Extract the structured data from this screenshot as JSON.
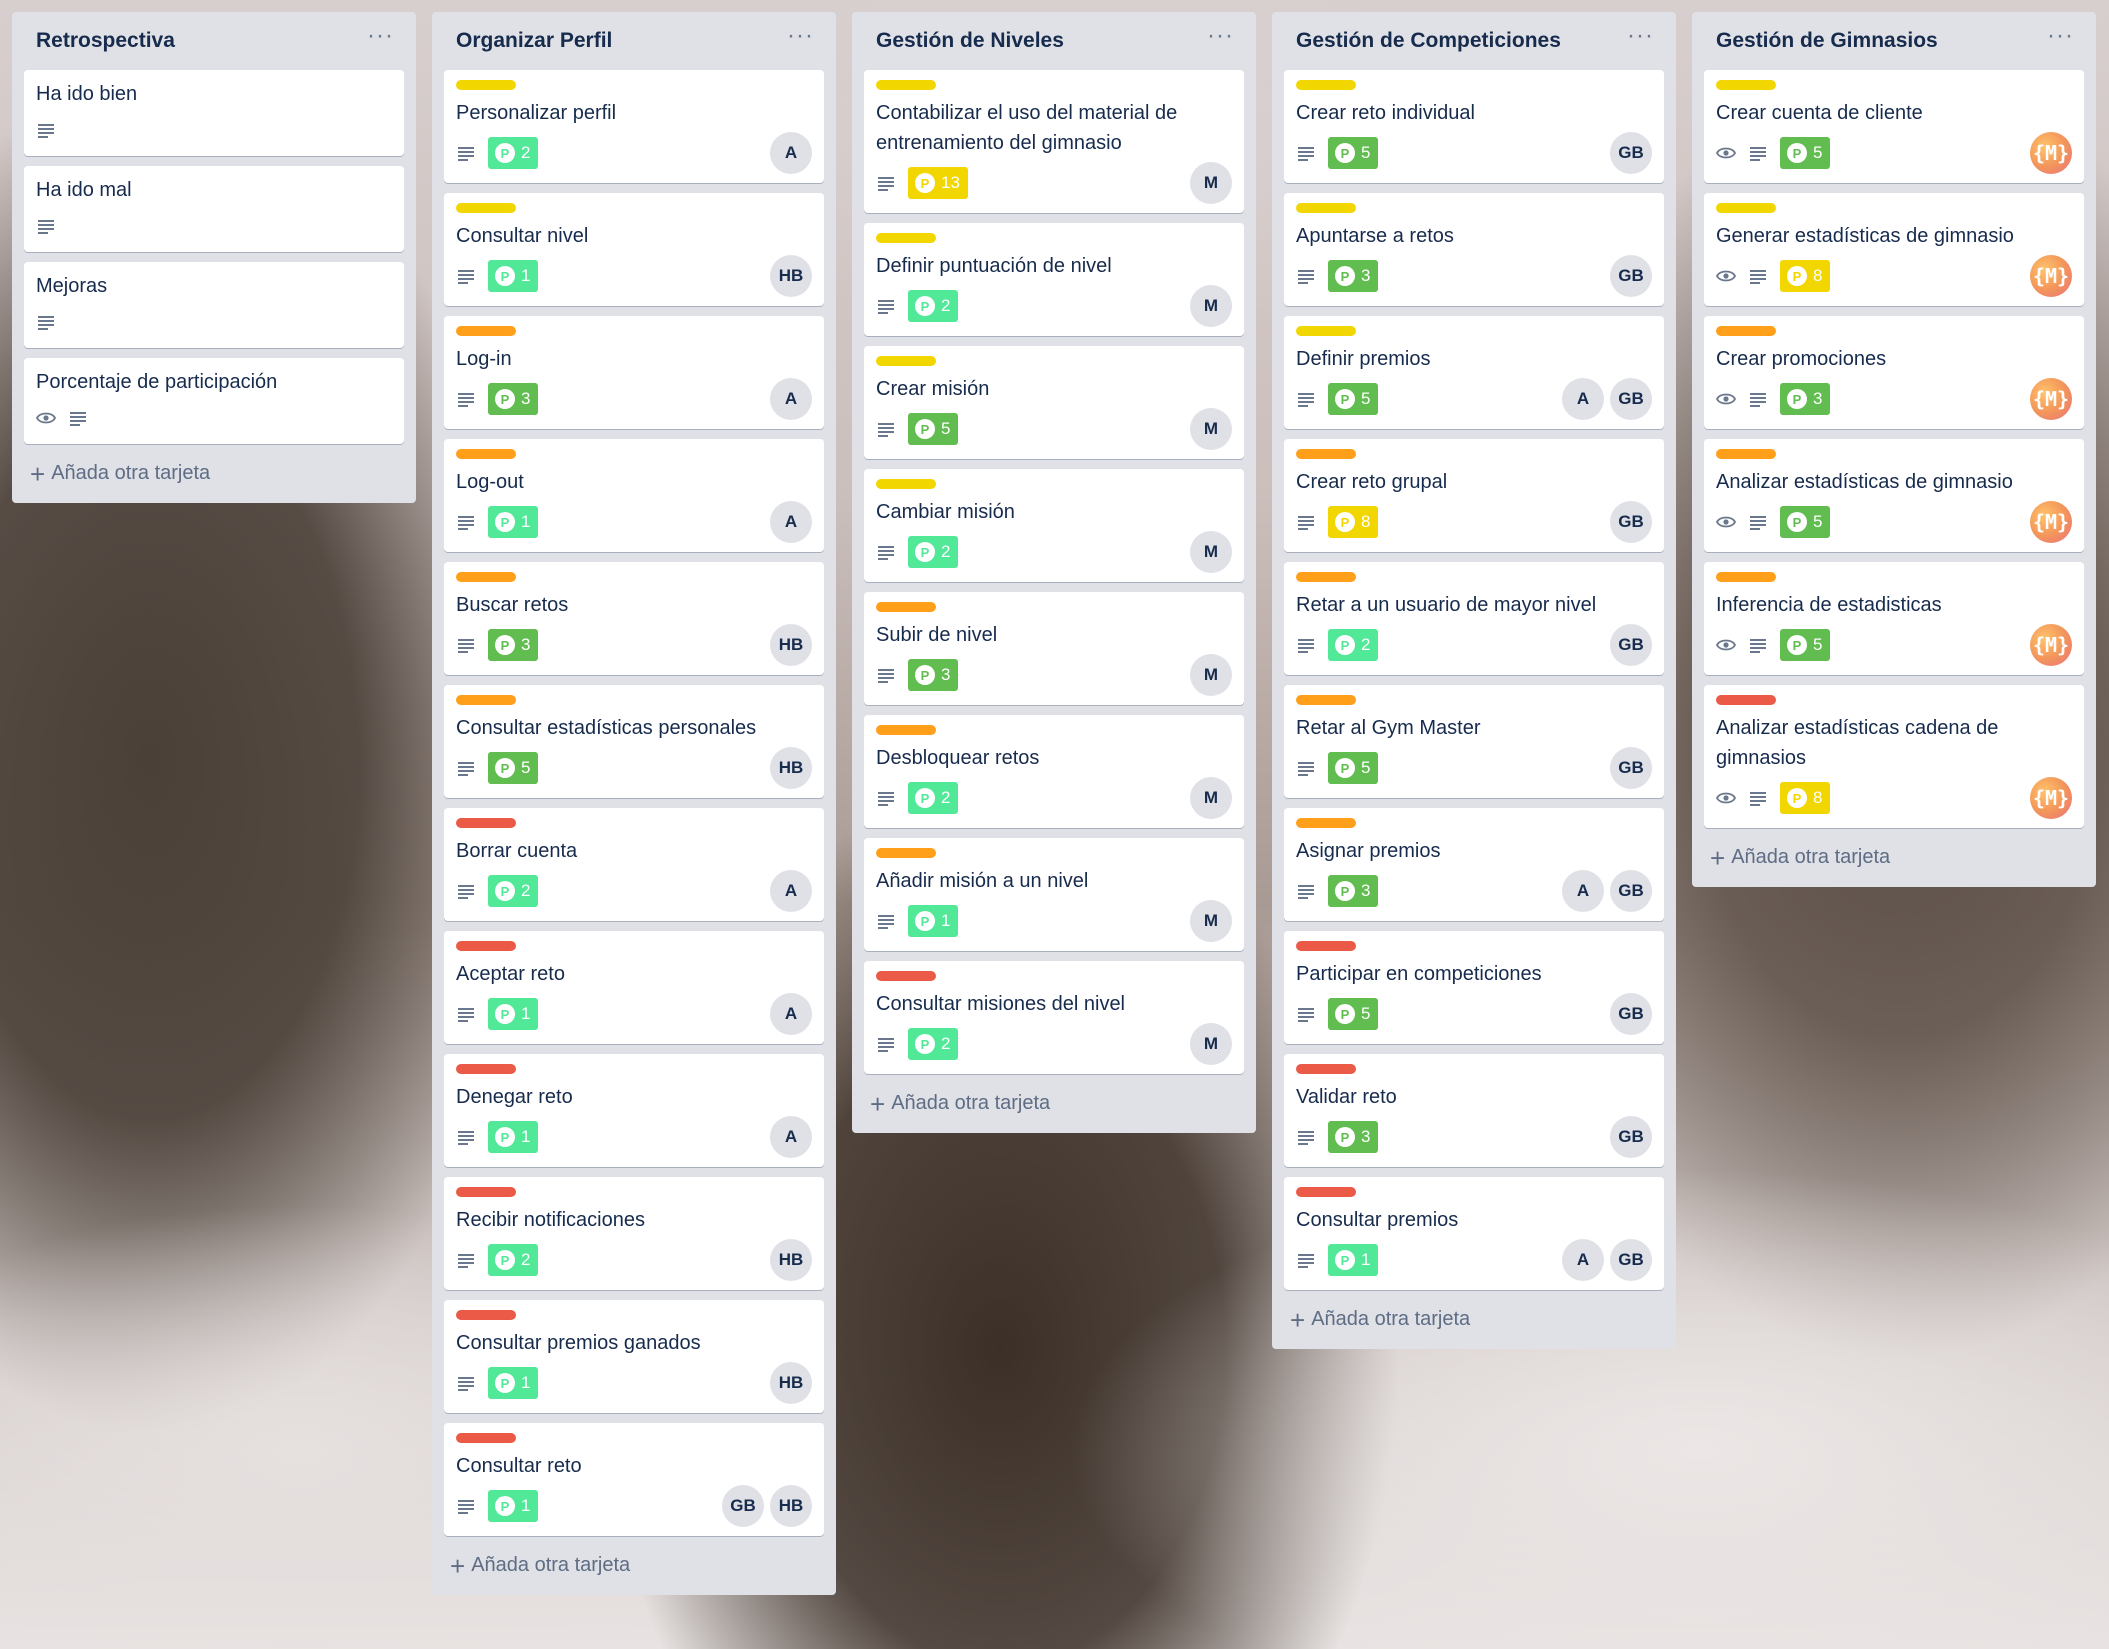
{
  "colors": {
    "label_yellow": "#f2d600",
    "label_orange": "#ff9f1a",
    "label_red": "#eb5a46",
    "points_green_light": "#51e898",
    "points_green": "#61bd4f",
    "points_yellow": "#f2d600"
  },
  "lists": [
    {
      "title": "Retrospectiva",
      "menu": "···",
      "add_card": "Añada otra tarjeta",
      "cards": [
        {
          "title": "Ha ido bien",
          "label": null,
          "watch": false,
          "description": true,
          "points": null,
          "members": []
        },
        {
          "title": "Ha ido mal",
          "label": null,
          "watch": false,
          "description": true,
          "points": null,
          "members": []
        },
        {
          "title": "Mejoras",
          "label": null,
          "watch": false,
          "description": true,
          "points": null,
          "members": []
        },
        {
          "title": "Porcentaje de participación",
          "label": null,
          "watch": true,
          "description": true,
          "points": null,
          "members": []
        }
      ]
    },
    {
      "title": "Organizar Perfil",
      "menu": "···",
      "add_card": "Añada otra tarjeta",
      "cards": [
        {
          "title": "Personalizar perfil",
          "label": "yellow",
          "watch": false,
          "description": true,
          "points": {
            "value": "2",
            "color": "green_light"
          },
          "members": [
            "A"
          ]
        },
        {
          "title": "Consultar nivel",
          "label": "yellow",
          "watch": false,
          "description": true,
          "points": {
            "value": "1",
            "color": "green_light"
          },
          "members": [
            "HB"
          ]
        },
        {
          "title": "Log-in",
          "label": "orange",
          "watch": false,
          "description": true,
          "points": {
            "value": "3",
            "color": "green"
          },
          "members": [
            "A"
          ]
        },
        {
          "title": "Log-out",
          "label": "orange",
          "watch": false,
          "description": true,
          "points": {
            "value": "1",
            "color": "green_light"
          },
          "members": [
            "A"
          ]
        },
        {
          "title": "Buscar retos",
          "label": "orange",
          "watch": false,
          "description": true,
          "points": {
            "value": "3",
            "color": "green"
          },
          "members": [
            "HB"
          ]
        },
        {
          "title": "Consultar estadísticas personales",
          "label": "orange",
          "watch": false,
          "description": true,
          "points": {
            "value": "5",
            "color": "green"
          },
          "members": [
            "HB"
          ]
        },
        {
          "title": "Borrar cuenta",
          "label": "red",
          "watch": false,
          "description": true,
          "points": {
            "value": "2",
            "color": "green_light"
          },
          "members": [
            "A"
          ]
        },
        {
          "title": "Aceptar reto",
          "label": "red",
          "watch": false,
          "description": true,
          "points": {
            "value": "1",
            "color": "green_light"
          },
          "members": [
            "A"
          ]
        },
        {
          "title": "Denegar reto",
          "label": "red",
          "watch": false,
          "description": true,
          "points": {
            "value": "1",
            "color": "green_light"
          },
          "members": [
            "A"
          ]
        },
        {
          "title": "Recibir notificaciones",
          "label": "red",
          "watch": false,
          "description": true,
          "points": {
            "value": "2",
            "color": "green_light"
          },
          "members": [
            "HB"
          ]
        },
        {
          "title": "Consultar premios ganados",
          "label": "red",
          "watch": false,
          "description": true,
          "points": {
            "value": "1",
            "color": "green_light"
          },
          "members": [
            "HB"
          ]
        },
        {
          "title": "Consultar reto",
          "label": "red",
          "watch": false,
          "description": true,
          "points": {
            "value": "1",
            "color": "green_light"
          },
          "members": [
            "GB",
            "HB"
          ]
        }
      ]
    },
    {
      "title": "Gestión de Niveles",
      "menu": "···",
      "add_card": "Añada otra tarjeta",
      "cards": [
        {
          "title": "Contabilizar el uso del material de entrenamiento del gimnasio",
          "label": "yellow",
          "watch": false,
          "description": true,
          "points": {
            "value": "13",
            "color": "yellow"
          },
          "members": [
            "M"
          ]
        },
        {
          "title": "Definir puntuación de nivel",
          "label": "yellow",
          "watch": false,
          "description": true,
          "points": {
            "value": "2",
            "color": "green_light"
          },
          "members": [
            "M"
          ]
        },
        {
          "title": "Crear misión",
          "label": "yellow",
          "watch": false,
          "description": true,
          "points": {
            "value": "5",
            "color": "green"
          },
          "members": [
            "M"
          ]
        },
        {
          "title": "Cambiar misión",
          "label": "yellow",
          "watch": false,
          "description": true,
          "points": {
            "value": "2",
            "color": "green_light"
          },
          "members": [
            "M"
          ]
        },
        {
          "title": "Subir de nivel",
          "label": "orange",
          "watch": false,
          "description": true,
          "points": {
            "value": "3",
            "color": "green"
          },
          "members": [
            "M"
          ]
        },
        {
          "title": "Desbloquear retos",
          "label": "orange",
          "watch": false,
          "description": true,
          "points": {
            "value": "2",
            "color": "green_light"
          },
          "members": [
            "M"
          ]
        },
        {
          "title": "Añadir misión a un nivel",
          "label": "orange",
          "watch": false,
          "description": true,
          "points": {
            "value": "1",
            "color": "green_light"
          },
          "members": [
            "M"
          ]
        },
        {
          "title": "Consultar misiones del nivel",
          "label": "red",
          "watch": false,
          "description": true,
          "points": {
            "value": "2",
            "color": "green_light"
          },
          "members": [
            "M"
          ]
        }
      ]
    },
    {
      "title": "Gestión de Competiciones",
      "menu": "···",
      "add_card": "Añada otra tarjeta",
      "cards": [
        {
          "title": "Crear reto individual",
          "label": "yellow",
          "watch": false,
          "description": true,
          "points": {
            "value": "5",
            "color": "green"
          },
          "members": [
            "GB"
          ]
        },
        {
          "title": "Apuntarse a retos",
          "label": "yellow",
          "watch": false,
          "description": true,
          "points": {
            "value": "3",
            "color": "green"
          },
          "members": [
            "GB"
          ]
        },
        {
          "title": "Definir premios",
          "label": "yellow",
          "watch": false,
          "description": true,
          "points": {
            "value": "5",
            "color": "green"
          },
          "members": [
            "A",
            "GB"
          ]
        },
        {
          "title": "Crear reto grupal",
          "label": "orange",
          "watch": false,
          "description": true,
          "points": {
            "value": "8",
            "color": "yellow"
          },
          "members": [
            "GB"
          ]
        },
        {
          "title": "Retar a un usuario de mayor nivel",
          "label": "orange",
          "watch": false,
          "description": true,
          "points": {
            "value": "2",
            "color": "green_light"
          },
          "members": [
            "GB"
          ]
        },
        {
          "title": "Retar al Gym Master",
          "label": "orange",
          "watch": false,
          "description": true,
          "points": {
            "value": "5",
            "color": "green"
          },
          "members": [
            "GB"
          ]
        },
        {
          "title": "Asignar premios",
          "label": "orange",
          "watch": false,
          "description": true,
          "points": {
            "value": "3",
            "color": "green"
          },
          "members": [
            "A",
            "GB"
          ]
        },
        {
          "title": "Participar en competiciones",
          "label": "red",
          "watch": false,
          "description": true,
          "points": {
            "value": "5",
            "color": "green"
          },
          "members": [
            "GB"
          ]
        },
        {
          "title": "Validar reto",
          "label": "red",
          "watch": false,
          "description": true,
          "points": {
            "value": "3",
            "color": "green"
          },
          "members": [
            "GB"
          ]
        },
        {
          "title": "Consultar premios",
          "label": "red",
          "watch": false,
          "description": true,
          "points": {
            "value": "1",
            "color": "green_light"
          },
          "members": [
            "A",
            "GB"
          ]
        }
      ]
    },
    {
      "title": "Gestión de Gimnasios",
      "menu": "···",
      "add_card": "Añada otra tarjeta",
      "cards": [
        {
          "title": "Crear cuenta de cliente",
          "label": "yellow",
          "watch": true,
          "description": true,
          "points": {
            "value": "5",
            "color": "green"
          },
          "members": [
            "{M}"
          ]
        },
        {
          "title": "Generar estadísticas de gimnasio",
          "label": "yellow",
          "watch": true,
          "description": true,
          "points": {
            "value": "8",
            "color": "yellow"
          },
          "members": [
            "{M}"
          ]
        },
        {
          "title": "Crear promociones",
          "label": "orange",
          "watch": true,
          "description": true,
          "points": {
            "value": "3",
            "color": "green"
          },
          "members": [
            "{M}"
          ]
        },
        {
          "title": "Analizar estadísticas de gimnasio",
          "label": "orange",
          "watch": true,
          "description": true,
          "points": {
            "value": "5",
            "color": "green"
          },
          "members": [
            "{M}"
          ]
        },
        {
          "title": "Inferencia de estadisticas",
          "label": "orange",
          "watch": true,
          "description": true,
          "points": {
            "value": "5",
            "color": "green"
          },
          "members": [
            "{M}"
          ]
        },
        {
          "title": "Analizar estadísticas cadena de gimnasios",
          "label": "red",
          "watch": true,
          "description": true,
          "points": {
            "value": "8",
            "color": "yellow"
          },
          "members": [
            "{M}"
          ]
        }
      ]
    }
  ]
}
